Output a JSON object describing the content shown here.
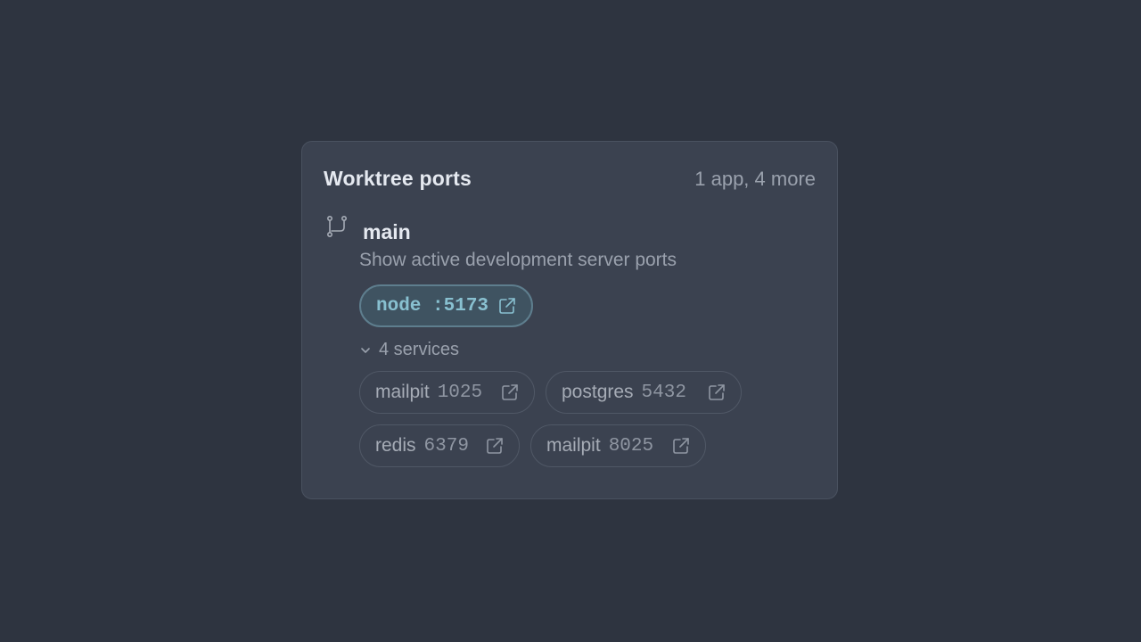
{
  "header": {
    "title": "Worktree ports",
    "summary": "1 app, 4 more"
  },
  "branch": {
    "icon": "git-branch-icon",
    "name": "main",
    "description": "Show active development server ports"
  },
  "app": {
    "label": "node :5173",
    "icon": "external-link-icon"
  },
  "services_toggle": {
    "label": "4 services",
    "icon": "chevron-down-icon",
    "expanded": true
  },
  "services": [
    {
      "name": "mailpit",
      "port": "1025"
    },
    {
      "name": "postgres",
      "port": "5432"
    },
    {
      "name": "redis",
      "port": "6379"
    },
    {
      "name": "mailpit",
      "port": "8025"
    }
  ],
  "colors": {
    "background": "#2e3440",
    "card": "#3b4250",
    "accent": "#88c0d0",
    "text_primary": "#e5e9f0",
    "text_muted": "#9aa1ad"
  }
}
